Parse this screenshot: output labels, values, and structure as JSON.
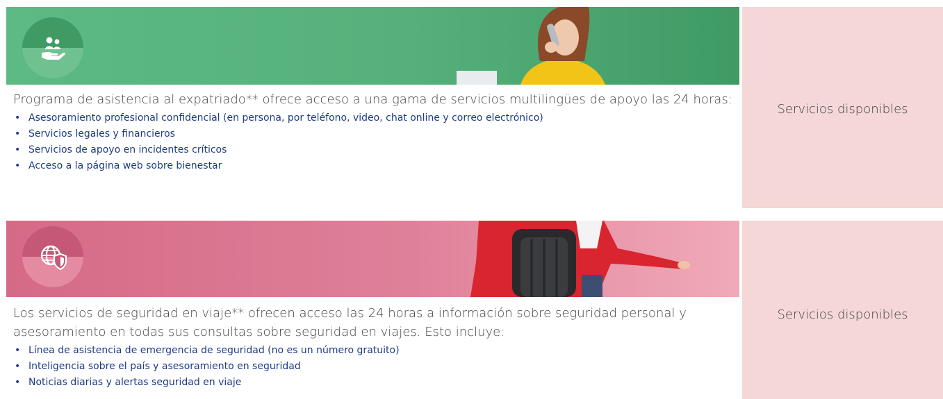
{
  "sections": [
    {
      "icon": "hand-holding-people-icon",
      "accent": "#5dba84",
      "description": "Programa de asistencia al expatriado** ofrece acceso a una gama de servicios multilingües de apoyo las 24 horas:",
      "items": [
        "Asesoramiento profesional confidencial (en persona, por teléfono, video, chat online y correo electrónico)",
        "Servicios legales y financieros",
        "Servicios de apoyo en incidentes críticos",
        "Acceso a la página web sobre bienestar"
      ],
      "availability": "Servicios disponibles"
    },
    {
      "icon": "globe-shield-icon",
      "accent": "#d56a86",
      "description": "Los servicios de seguridad en viaje** ofrecen acceso las 24 horas a información sobre seguridad personal y asesoramiento en todas sus consultas sobre seguridad en viajes. Esto incluye:",
      "items": [
        "Línea de asistencia de emergencia de seguridad (no es un número gratuito)",
        "Inteligencia sobre el país y asesoramiento en seguridad",
        "Noticias diarias y alertas seguridad en viaje"
      ],
      "availability": "Servicios disponibles"
    }
  ],
  "colors": {
    "link_blue": "#1f3c84",
    "sidebar_bg": "#f4d7d6",
    "text_gray": "#414141"
  }
}
